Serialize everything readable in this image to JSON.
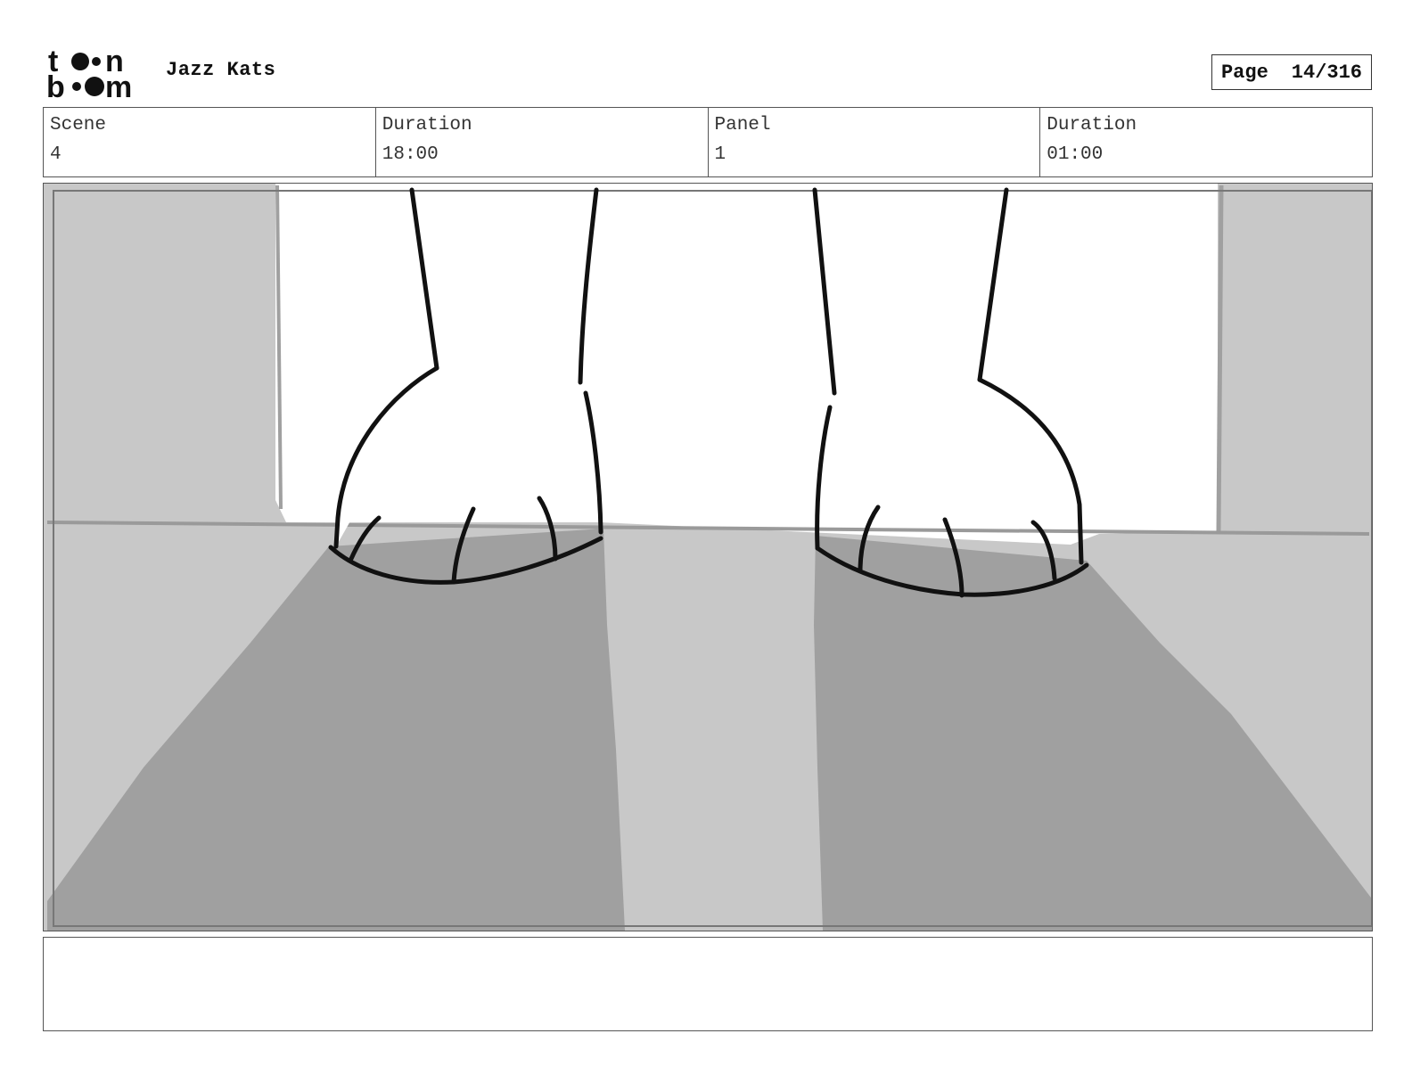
{
  "header": {
    "logo_top": "t••n",
    "logo_bottom": "b••m",
    "project_title": "Jazz Kats",
    "page_label": "Page",
    "page_value": "14/316"
  },
  "info": {
    "scene_label": "Scene",
    "scene_value": "4",
    "scene_duration_label": "Duration",
    "scene_duration_value": "18:00",
    "panel_label": "Panel",
    "panel_value": "1",
    "panel_duration_label": "Duration",
    "panel_duration_value": "01:00"
  },
  "notes": {
    "text": ""
  },
  "colors": {
    "light_gray": "#c8c8c8",
    "mid_gray": "#a0a0a0",
    "line": "#111111",
    "white": "#ffffff"
  }
}
